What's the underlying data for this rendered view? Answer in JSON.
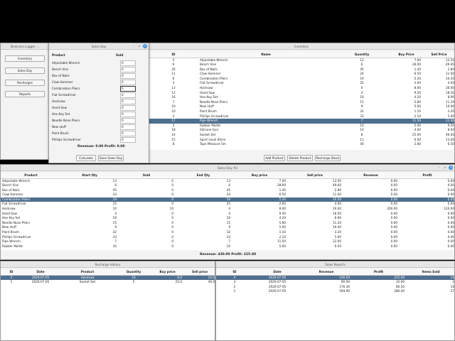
{
  "business_logger": {
    "title": "Business Logger ...",
    "buttons": [
      "Inventory",
      "Sales Day",
      "Recharges",
      "Reports"
    ]
  },
  "inventory": {
    "title": "Inventory",
    "columns": [
      "ID",
      "Name",
      "Quantity",
      "Buy Price",
      "Sell Price"
    ],
    "rows": [
      [
        "5",
        "Adjustable Wrench",
        "13",
        "7.00",
        "13.50"
      ],
      [
        "9",
        "Bench Vise",
        "6",
        "28.00",
        "49.00"
      ],
      [
        "20",
        "Box of Nails",
        "45",
        "1.40",
        "2.80"
      ],
      [
        "11",
        "Claw Hammer",
        "24",
        "6.50",
        "11.00"
      ],
      [
        "6",
        "Combination Pliers",
        "19",
        "5.20",
        "10.50"
      ],
      [
        "4",
        "Flat Screwdriver",
        "25",
        "2.00",
        "4.00"
      ],
      [
        "13",
        "Hacksaw",
        "0",
        "8.00",
        "20.00"
      ],
      [
        "12",
        "Hand Saw",
        "4",
        "9.50",
        "18.50"
      ],
      [
        "16",
        "Hex Key Set",
        "19",
        "4.20",
        "8.90"
      ],
      [
        "7",
        "Needle Nose Pliers",
        "15",
        "5.80",
        "11.20"
      ],
      [
        "19",
        "New stuff",
        "9",
        "5.00",
        "10.00"
      ],
      [
        "10",
        "Paint Brush",
        "32",
        "1.10",
        "3.20"
      ],
      [
        "3",
        "Phillips Screwdriver",
        "33",
        "2.10",
        "5.00"
      ],
      [
        "17",
        "Pipe Wrench",
        "7",
        "11.50",
        "22.00"
      ],
      [
        "2",
        "Rubber Mallet",
        "10",
        "5.00",
        "9.50"
      ],
      [
        "18",
        "Silicone Gun",
        "10",
        "4.00",
        "8.00"
      ],
      [
        "14",
        "Socket Set",
        "8",
        "25.00",
        "46.00"
      ],
      [
        "15",
        "Spirit Level 60cm",
        "11",
        "6.00",
        "13.00"
      ],
      [
        "8",
        "Tape Measure 5m",
        "40",
        "2.80",
        "6.50"
      ]
    ],
    "selected_row": 13,
    "buttons": [
      "Add Product",
      "Delete Product",
      "Recharge Stock"
    ]
  },
  "sales_day": {
    "title": "Sales Day",
    "columns": [
      "Product",
      "Sold"
    ],
    "products": [
      "Adjustable Wrench",
      "Bench Vise",
      "Box of Nails",
      "Claw Hammer",
      "Combination Pliers",
      "Flat Screwdriver",
      "Hacksaw",
      "Hand Saw",
      "Hex Key Set",
      "Needle Nose Pliers",
      "New stuff",
      "Paint Brush",
      "Phillips Screwdriver"
    ],
    "values": [
      "0",
      "0",
      "0",
      "0",
      "6",
      "0",
      "0",
      "0",
      "0",
      "0",
      "0",
      "0",
      "0"
    ],
    "active_index": 4,
    "revenue_label": "Revenue: 0.00",
    "profit_label": "Profit: 0.00",
    "buttons": [
      "Calculate",
      "Save Sales Day"
    ]
  },
  "sales_day_detail": {
    "title": "Sales Day #3",
    "columns": [
      "Product",
      "Start Qty",
      "Sold",
      "End Qty",
      "Buy price",
      "Sell price",
      "Revenue",
      "Profit"
    ],
    "rows": [
      [
        "Adjustable Wrench",
        "13",
        "0",
        "13",
        "7.00",
        "13.50",
        "0.00",
        "0.00"
      ],
      [
        "Bench Vise",
        "6",
        "0",
        "6",
        "28.00",
        "49.00",
        "0.00",
        "0.00"
      ],
      [
        "Box of Nails",
        "45",
        "0",
        "45",
        "1.40",
        "2.80",
        "0.00",
        "0.00"
      ],
      [
        "Claw Hammer",
        "24",
        "0",
        "24",
        "6.50",
        "11.00",
        "0.00",
        "0.00"
      ],
      [
        "Combination Pliers",
        "19",
        "0",
        "19",
        "5.20",
        "10.50",
        "0.00",
        "0.00"
      ],
      [
        "Flat Screwdriver",
        "25",
        "0",
        "25",
        "2.00",
        "4.00",
        "0.00",
        "0.00"
      ],
      [
        "Hacksaw",
        "10",
        "10",
        "0",
        "8.00",
        "20.00",
        "200.00",
        "120.00"
      ],
      [
        "Hand Saw",
        "4",
        "0",
        "4",
        "9.50",
        "18.50",
        "0.00",
        "0.00"
      ],
      [
        "Hex Key Set",
        "19",
        "0",
        "19",
        "4.20",
        "8.90",
        "0.00",
        "0.00"
      ],
      [
        "Needle Nose Pliers",
        "15",
        "0",
        "15",
        "5.80",
        "11.20",
        "0.00",
        "0.00"
      ],
      [
        "New stuff",
        "9",
        "0",
        "9",
        "5.00",
        "10.00",
        "0.00",
        "0.00"
      ],
      [
        "Paint Brush",
        "32",
        "0",
        "32",
        "1.10",
        "3.20",
        "0.00",
        "0.00"
      ],
      [
        "Phillips Screwdriver",
        "33",
        "0",
        "33",
        "2.10",
        "5.00",
        "0.00",
        "0.00"
      ],
      [
        "Pipe Wrench",
        "7",
        "0",
        "7",
        "11.50",
        "22.00",
        "0.00",
        "0.00"
      ],
      [
        "Rubber Mallet",
        "10",
        "0",
        "10",
        "5.00",
        "9.50",
        "0.00",
        "0.00"
      ]
    ],
    "selected_row": 4,
    "summary": "Revenue: 430.00   Profit: 225.00"
  },
  "recharge_history": {
    "title": "Recharge History",
    "columns": [
      "ID",
      "Date",
      "Product",
      "Quantity",
      "Buy price",
      "Sell price"
    ],
    "rows": [
      [
        "2",
        "2026-07-05",
        "Hacksaw",
        "10",
        "8.0",
        "20.0"
      ],
      [
        "1",
        "2026-07-05",
        "Socket Set",
        "5",
        "25.0",
        "46.0"
      ]
    ],
    "selected_row": 0
  },
  "sales_reports": {
    "title": "Sales Reports",
    "columns": [
      "ID",
      "Date",
      "Revenue",
      "Profit",
      "Items Sold"
    ],
    "rows": [
      [
        "4",
        "2026-07-05",
        "430.00",
        "225.00",
        "10"
      ],
      [
        "3",
        "2026-07-05",
        "80.00",
        "32.00",
        "2"
      ],
      [
        "2",
        "2026-07-05",
        "176.30",
        "80.50",
        "16"
      ],
      [
        "1",
        "2026-07-05",
        "594.90",
        "286.40",
        "27"
      ]
    ],
    "selected_row": 0
  },
  "colors": {
    "selection": "#4f6f8f",
    "close_button": "#3d8ee0",
    "desktop": "#000000"
  }
}
